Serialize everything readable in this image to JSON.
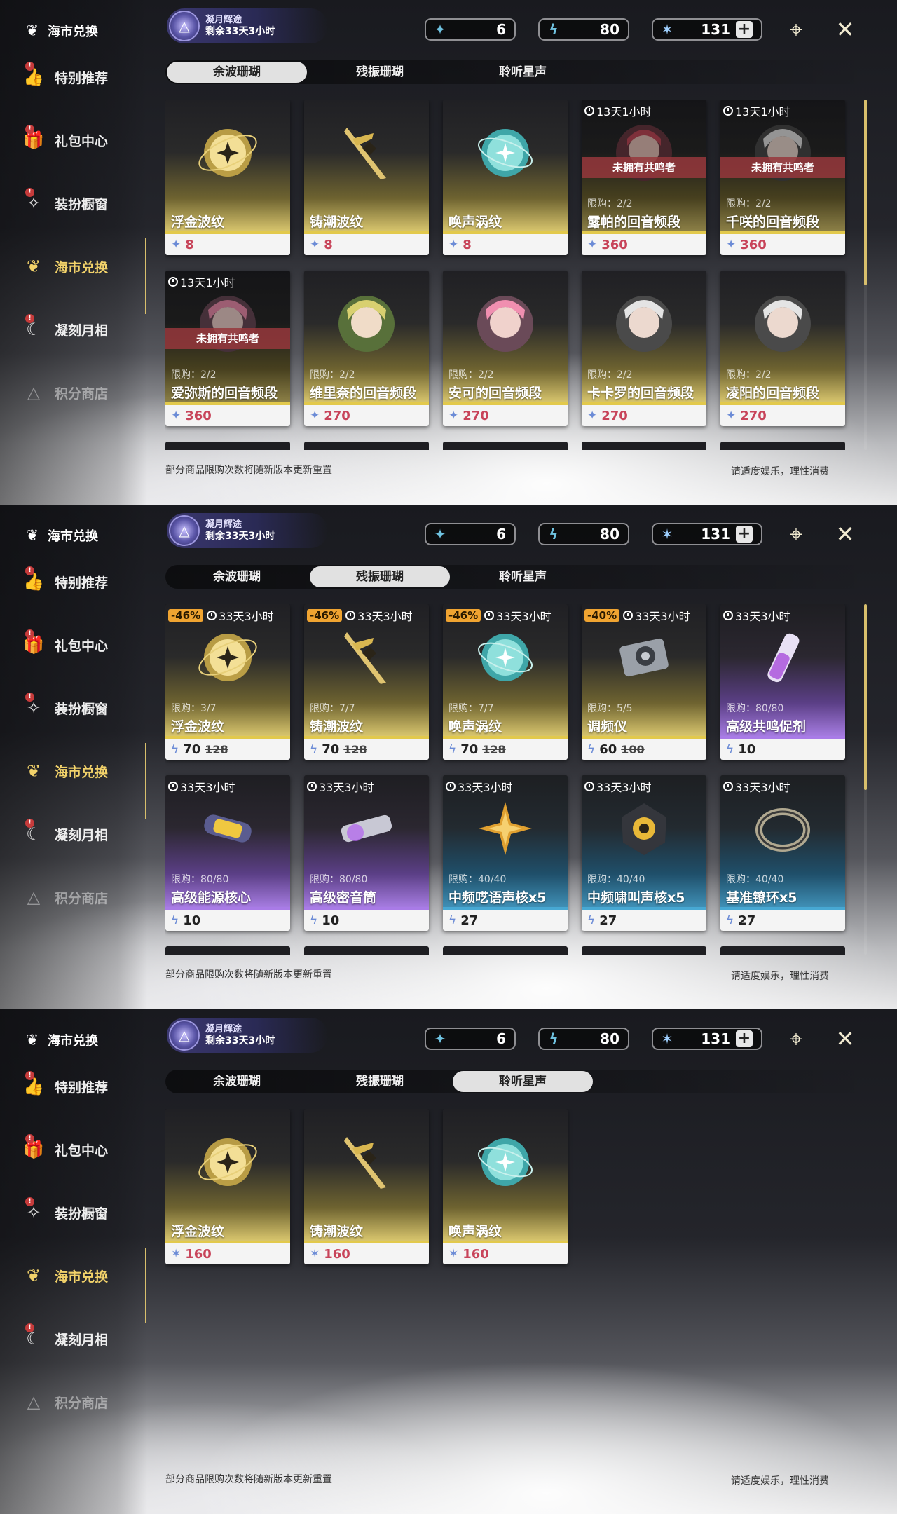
{
  "sidebar": {
    "title": "海市兑换",
    "items": [
      {
        "label": "特别推荐",
        "icon": "thumbs-up-icon",
        "badge": "!",
        "state": "normal"
      },
      {
        "label": "礼包中心",
        "icon": "gift-icon",
        "badge": "!",
        "state": "normal"
      },
      {
        "label": "装扮橱窗",
        "icon": "wardrobe-icon",
        "badge": "!",
        "state": "normal"
      },
      {
        "label": "海市兑换",
        "icon": "coral-tree-icon",
        "badge": "",
        "state": "active"
      },
      {
        "label": "凝刻月相",
        "icon": "moon-phase-icon",
        "badge": "!",
        "state": "normal"
      },
      {
        "label": "积分商店",
        "icon": "triangle-emblem-icon",
        "badge": "",
        "state": "dim"
      }
    ]
  },
  "event": {
    "name": "凝月辉途",
    "remaining": "剩余33天3小时"
  },
  "currencies": [
    {
      "icon": "afterglow-coral-icon",
      "value": "6"
    },
    {
      "icon": "oscillated-coral-icon",
      "value": "80"
    },
    {
      "icon": "star-sound-icon",
      "value": "131",
      "plus": "+"
    }
  ],
  "tabs": [
    "余波珊瑚",
    "残振珊瑚",
    "聆听星声"
  ],
  "footer": {
    "left": "部分商品限购次数将随新版本更新重置",
    "right": "请适度娱乐，理性消费"
  },
  "panels": [
    {
      "selected_tab": 0,
      "cards": [
        {
          "name": "浮金波纹",
          "price": "8",
          "price_red": true,
          "theme": "gold",
          "art": "orb-gold",
          "timer": "",
          "limit": "",
          "owned": ""
        },
        {
          "name": "铸潮波纹",
          "price": "8",
          "price_red": true,
          "theme": "gold",
          "art": "sword-gold",
          "timer": "",
          "limit": "",
          "owned": ""
        },
        {
          "name": "唤声涡纹",
          "price": "8",
          "price_red": true,
          "theme": "gold",
          "art": "orb-teal",
          "timer": "",
          "limit": "",
          "owned": ""
        },
        {
          "name": "露帕的回音频段",
          "price": "360",
          "price_red": true,
          "theme": "gold",
          "art": "portrait-red",
          "timer": "13天1小时",
          "limit": "限购：2/2",
          "owned": "未拥有共鸣者",
          "dim": true
        },
        {
          "name": "千咲的回音频段",
          "price": "360",
          "price_red": true,
          "theme": "gold",
          "art": "portrait-white",
          "timer": "13天1小时",
          "limit": "限购：2/2",
          "owned": "未拥有共鸣者",
          "dim": true
        },
        {
          "name": "爱弥斯的回音频段",
          "price": "360",
          "price_red": true,
          "theme": "gold",
          "art": "portrait-pink",
          "timer": "13天1小时",
          "limit": "限购：2/2",
          "owned": "未拥有共鸣者",
          "dim": true
        },
        {
          "name": "维里奈的回音频段",
          "price": "270",
          "price_red": true,
          "theme": "gold",
          "art": "portrait-green",
          "timer": "",
          "limit": "限购：2/2",
          "owned": ""
        },
        {
          "name": "安可的回音频段",
          "price": "270",
          "price_red": true,
          "theme": "gold",
          "art": "portrait-pink",
          "timer": "",
          "limit": "限购：2/2",
          "owned": ""
        },
        {
          "name": "卡卡罗的回音频段",
          "price": "270",
          "price_red": true,
          "theme": "gold",
          "art": "portrait-white",
          "timer": "",
          "limit": "限购：2/2",
          "owned": ""
        },
        {
          "name": "凌阳的回音频段",
          "price": "270",
          "price_red": true,
          "theme": "gold",
          "art": "portrait-white",
          "timer": "",
          "limit": "限购：2/2",
          "owned": ""
        }
      ],
      "peek": true
    },
    {
      "selected_tab": 1,
      "cards": [
        {
          "name": "浮金波纹",
          "price": "70",
          "old": "128",
          "theme": "gold",
          "art": "orb-gold",
          "timer": "33天3小时",
          "discount": "-46%",
          "limit": "限购：3/7"
        },
        {
          "name": "铸潮波纹",
          "price": "70",
          "old": "128",
          "theme": "gold",
          "art": "sword-gold",
          "timer": "33天3小时",
          "discount": "-46%",
          "limit": "限购：7/7"
        },
        {
          "name": "唤声涡纹",
          "price": "70",
          "old": "128",
          "theme": "gold",
          "art": "orb-teal",
          "timer": "33天3小时",
          "discount": "-46%",
          "limit": "限购：7/7"
        },
        {
          "name": "调频仪",
          "price": "60",
          "old": "100",
          "theme": "gold",
          "art": "device",
          "timer": "33天3小时",
          "discount": "-40%",
          "limit": "限购：5/5"
        },
        {
          "name": "高级共鸣促剂",
          "price": "10",
          "old": "",
          "theme": "purple",
          "art": "vial",
          "timer": "33天3小时",
          "discount": "",
          "limit": "限购：80/80"
        },
        {
          "name": "高级能源核心",
          "price": "10",
          "old": "",
          "theme": "purple",
          "art": "capsule",
          "timer": "33天3小时",
          "discount": "",
          "limit": "限购：80/80"
        },
        {
          "name": "高级密音筒",
          "price": "10",
          "old": "",
          "theme": "purple",
          "art": "cylinder",
          "timer": "33天3小时",
          "discount": "",
          "limit": "限购：80/80"
        },
        {
          "name": "中频呓语声核x5",
          "price": "27",
          "old": "",
          "theme": "teal",
          "art": "star-gold",
          "timer": "33天3小时",
          "discount": "",
          "limit": "限购：40/40"
        },
        {
          "name": "中频啸叫声核x5",
          "price": "27",
          "old": "",
          "theme": "teal",
          "art": "core-dark",
          "timer": "33天3小时",
          "discount": "",
          "limit": "限购：40/40"
        },
        {
          "name": "基准镣环x5",
          "price": "27",
          "old": "",
          "theme": "teal",
          "art": "ring",
          "timer": "33天3小时",
          "discount": "",
          "limit": "限购：40/40"
        }
      ],
      "peek": true
    },
    {
      "selected_tab": 2,
      "cards": [
        {
          "name": "浮金波纹",
          "price": "160",
          "price_red": true,
          "theme": "gold",
          "art": "orb-gold"
        },
        {
          "name": "铸潮波纹",
          "price": "160",
          "price_red": true,
          "theme": "gold",
          "art": "sword-gold"
        },
        {
          "name": "唤声涡纹",
          "price": "160",
          "price_red": true,
          "theme": "gold",
          "art": "orb-teal"
        }
      ],
      "peek": false
    }
  ],
  "colors": {
    "accent_gold": "#e2c94c",
    "active_nav": "#f2d26a",
    "price_red": "#c8445a",
    "discount": "#f0a431",
    "owned_banner": "#963740"
  }
}
